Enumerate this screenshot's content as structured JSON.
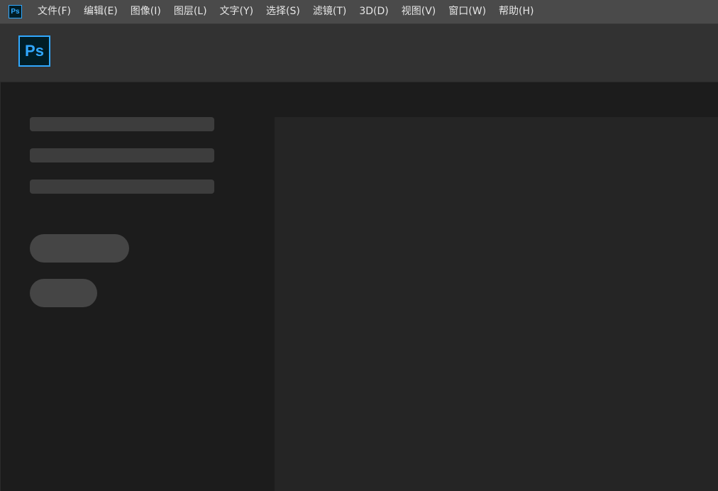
{
  "app": {
    "name": "Adobe Photoshop",
    "icon_label": "Ps",
    "logo_label": "Ps",
    "brand_color": "#31a8ff"
  },
  "menubar": {
    "items": [
      {
        "label": "文件(F)"
      },
      {
        "label": "编辑(E)"
      },
      {
        "label": "图像(I)"
      },
      {
        "label": "图层(L)"
      },
      {
        "label": "文字(Y)"
      },
      {
        "label": "选择(S)"
      },
      {
        "label": "滤镜(T)"
      },
      {
        "label": "3D(D)"
      },
      {
        "label": "视图(V)"
      },
      {
        "label": "窗口(W)"
      },
      {
        "label": "帮助(H)"
      }
    ]
  },
  "home": {
    "loading_state": true,
    "placeholder_bars": 3,
    "placeholder_buttons": 2
  }
}
